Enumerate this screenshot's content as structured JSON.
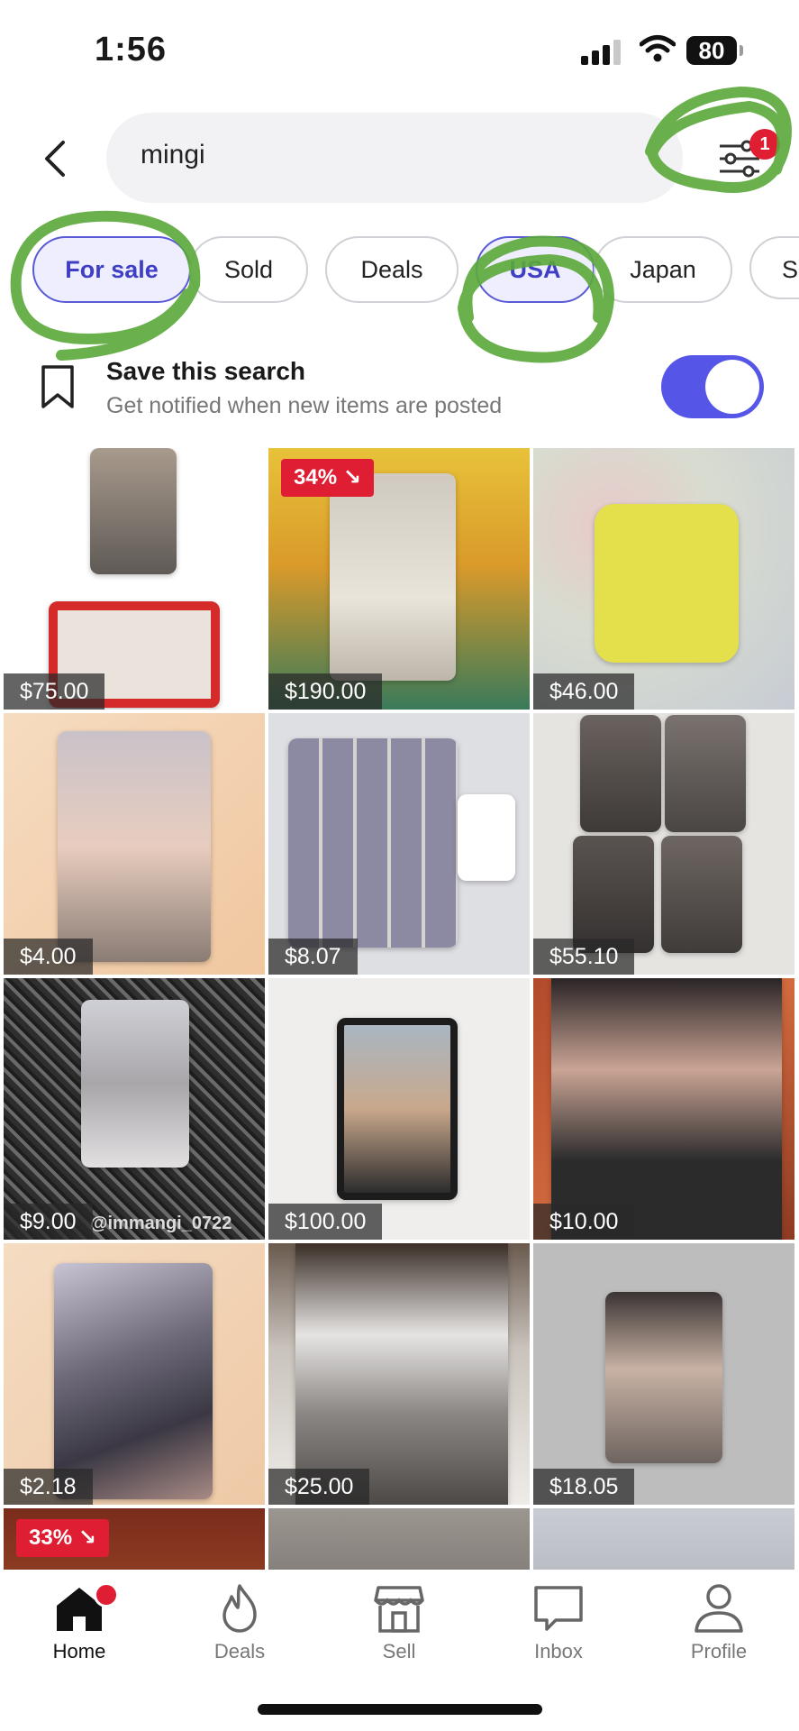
{
  "status_bar": {
    "time": "1:56",
    "battery": "80"
  },
  "search": {
    "query": "mingi",
    "filter_badge": "1"
  },
  "chips": [
    {
      "label": "For sale",
      "active": true
    },
    {
      "label": "Sold",
      "active": false
    },
    {
      "label": "Deals",
      "active": false
    },
    {
      "label": "USA",
      "active": true
    },
    {
      "label": "Japan",
      "active": false
    },
    {
      "label": "S",
      "active": false
    }
  ],
  "save_search": {
    "title": "Save this search",
    "subtitle": "Get notified when new items are posted",
    "enabled": true
  },
  "listings": [
    {
      "price": "$75.00"
    },
    {
      "price": "$190.00",
      "discount": "34% ↘"
    },
    {
      "price": "$46.00"
    },
    {
      "price": "$4.00"
    },
    {
      "price": "$8.07"
    },
    {
      "price": "$55.10"
    },
    {
      "price": "$9.00",
      "watermark": "@immangi_0722"
    },
    {
      "price": "$100.00"
    },
    {
      "price": "$10.00"
    },
    {
      "price": "$2.18"
    },
    {
      "price": "$25.00"
    },
    {
      "price": "$18.05"
    },
    {
      "discount": "33% ↘"
    },
    {},
    {}
  ],
  "bottom_nav": [
    {
      "label": "Home",
      "icon": "home-icon",
      "active": true
    },
    {
      "label": "Deals",
      "icon": "flame-icon",
      "active": false
    },
    {
      "label": "Sell",
      "icon": "storefront-icon",
      "active": false
    },
    {
      "label": "Inbox",
      "icon": "chat-bubble-icon",
      "active": false
    },
    {
      "label": "Profile",
      "icon": "person-icon",
      "active": false
    }
  ],
  "colors": {
    "accent": "#5555e8",
    "badge_red": "#e01e33",
    "annotation_green": "#5aa83a"
  }
}
